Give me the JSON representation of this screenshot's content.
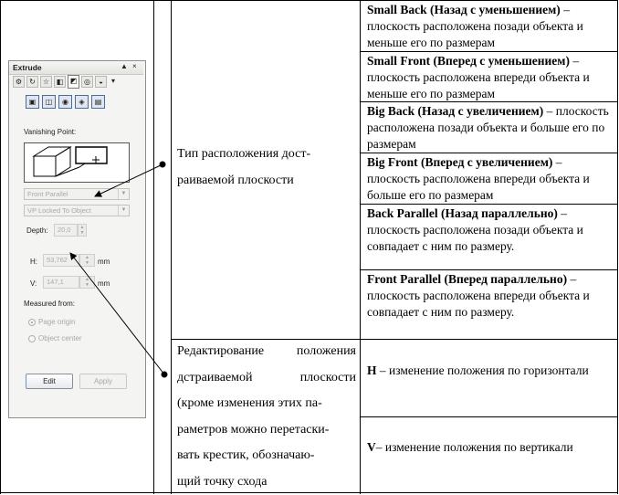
{
  "panel": {
    "title": "Extrude",
    "title_controls": [
      "▲",
      "×"
    ],
    "tab_icons": [
      "preset-icon",
      "rotate-icon",
      "light-icon",
      "color-icon",
      "bevel-icon",
      "depth-icon",
      "sphere-icon",
      "extrude-icon"
    ],
    "type_icons": [
      "extrude-type-1-icon",
      "extrude-type-2-icon",
      "extrude-type-3-icon",
      "extrude-type-4-icon",
      "extrude-type-5-icon"
    ],
    "vanishing_point_label": "Vanishing Point:",
    "dropdown_type": "Front Parallel",
    "dropdown_vp": "VP Locked To Object",
    "depth_label": "Depth:",
    "depth_value": "20,0",
    "h_label": "H:",
    "h_value": "53,762",
    "h_unit": "mm",
    "v_label": "V:",
    "v_value": "147,1",
    "v_unit": "mm",
    "measured_from_label": "Measured from:",
    "radio_page_origin": "Page origin",
    "radio_object_center": "Object center",
    "edit_button": "Edit",
    "apply_button": "Apply"
  },
  "middle": {
    "row1_text": [
      "Тип расположения дост-",
      "раиваемой плоскости"
    ],
    "row2_text": [
      "Редактирование положения",
      "дстраиваемой плоскости",
      "(кроме изменения этих па-",
      "раметров можно перетаски-",
      "вать крестик, обозначаю-",
      "щий точку схода"
    ]
  },
  "right": {
    "items": [
      {
        "bold": "Small Back (Назад с уменьшением)",
        "text": " – плоскость расположена позади объекта и меньше его по размерам"
      },
      {
        "bold": "Small Front (Вперед с уменьшением)",
        "text": " – плоскость расположена впереди объекта и меньше его по размерам"
      },
      {
        "bold": "Big Back (Назад с увеличением)",
        "text": " – плоскость расположена позади объекта и больше его по размерам"
      },
      {
        "bold": "Big Front (Вперед с увеличением)",
        "text": " – плоскость расположена впереди объекта и больше его по размерам"
      },
      {
        "bold": "Back Parallel (Назад параллельно)",
        "text": " – плоскость расположена позади объекта и совпадает с ним  по размеру."
      },
      {
        "bold": "Front Parallel (Вперед параллельно)",
        "text": " – плоскость расположена впереди объекта и совпадает с ним  по размеру."
      }
    ],
    "h_item": {
      "bold": "H",
      "text": " – изменение положения по горизонтали"
    },
    "v_item": {
      "bold": "V",
      "text": "– изменение положения по вертикали"
    }
  }
}
